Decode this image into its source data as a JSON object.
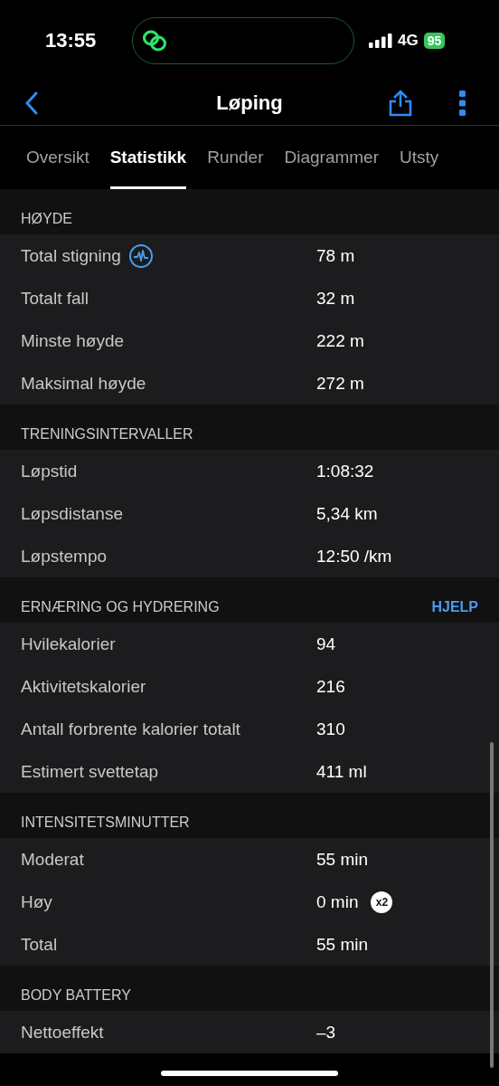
{
  "status_bar": {
    "time": "13:55",
    "network": "4G",
    "battery": "95"
  },
  "nav": {
    "title": "Løping"
  },
  "tabs": [
    {
      "label": "Oversikt",
      "selected": false
    },
    {
      "label": "Statistikk",
      "selected": true
    },
    {
      "label": "Runder",
      "selected": false
    },
    {
      "label": "Diagrammer",
      "selected": false
    },
    {
      "label": "Utsty",
      "selected": false
    }
  ],
  "sections": [
    {
      "title": "HØYDE",
      "rows": [
        {
          "label": "Total stigning",
          "value": "78 m",
          "info_icon": true
        },
        {
          "label": "Totalt fall",
          "value": "32 m"
        },
        {
          "label": "Minste høyde",
          "value": "222 m"
        },
        {
          "label": "Maksimal høyde",
          "value": "272 m"
        }
      ]
    },
    {
      "title": "TRENINGSINTERVALLER",
      "rows": [
        {
          "label": "Løpstid",
          "value": "1:08:32"
        },
        {
          "label": "Løpsdistanse",
          "value": "5,34 km"
        },
        {
          "label": "Løpstempo",
          "value": "12:50 /km"
        }
      ]
    },
    {
      "title": "ERNÆRING OG HYDRERING",
      "link": "HJELP",
      "rows": [
        {
          "label": "Hvilekalorier",
          "value": "94"
        },
        {
          "label": "Aktivitetskalorier",
          "value": "216"
        },
        {
          "label": "Antall forbrente kalorier totalt",
          "value": "310"
        },
        {
          "label": "Estimert svettetap",
          "value": "411 ml"
        }
      ]
    },
    {
      "title": "INTENSITETSMINUTTER",
      "rows": [
        {
          "label": "Moderat",
          "value": "55 min"
        },
        {
          "label": "Høy",
          "value": "0 min",
          "badge": "x2"
        },
        {
          "label": "Total",
          "value": "55 min"
        }
      ]
    },
    {
      "title": "BODY BATTERY",
      "rows": [
        {
          "label": "Nettoeffekt",
          "value": "–3"
        }
      ]
    }
  ]
}
